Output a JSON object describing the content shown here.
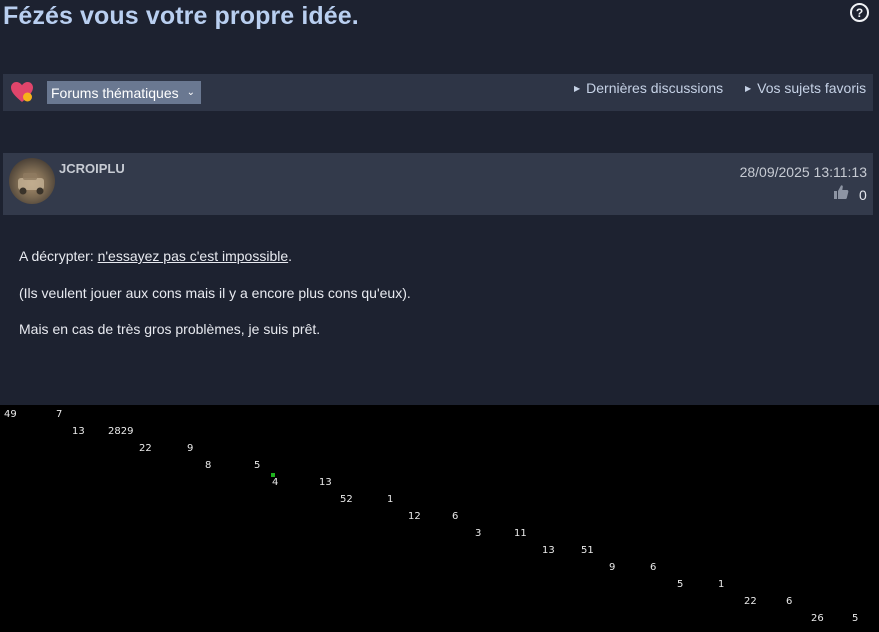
{
  "page": {
    "title": "Fézés vous votre propre idée.",
    "help_icon": "question-circle-icon"
  },
  "navbar": {
    "logo_icon": "heart-logo-icon",
    "forums_button": "Forums thématiques",
    "links": [
      "Dernières discussions",
      "Vos sujets favoris"
    ]
  },
  "post": {
    "username": "JCROIPLU",
    "date": "28/09/2025 13:11:13",
    "likes": "0",
    "line1_prefix": "A décrypter: ",
    "line1_link": "n'essayez pas c'est impossible",
    "line1_suffix": ".",
    "line2": "(Ils veulent jouer aux cons mais il y a encore plus cons qu'eux).",
    "line3": "Mais en cas de très gros problèmes, je suis prêt."
  },
  "cipher": {
    "numbers": [
      "49",
      "7",
      "13",
      "2829",
      "22",
      "9",
      "8",
      "5",
      "4",
      "13",
      "52",
      "1",
      "12",
      "6",
      "3",
      "11",
      "13",
      "51",
      "9",
      "6",
      "5",
      "1",
      "22",
      "6",
      "26",
      "5"
    ]
  },
  "colors": {
    "background": "#1d2230",
    "navbar": "#2e3546",
    "title": "#b9cff0",
    "forums_button": "#6a7891",
    "cipher_background": "#000000"
  }
}
